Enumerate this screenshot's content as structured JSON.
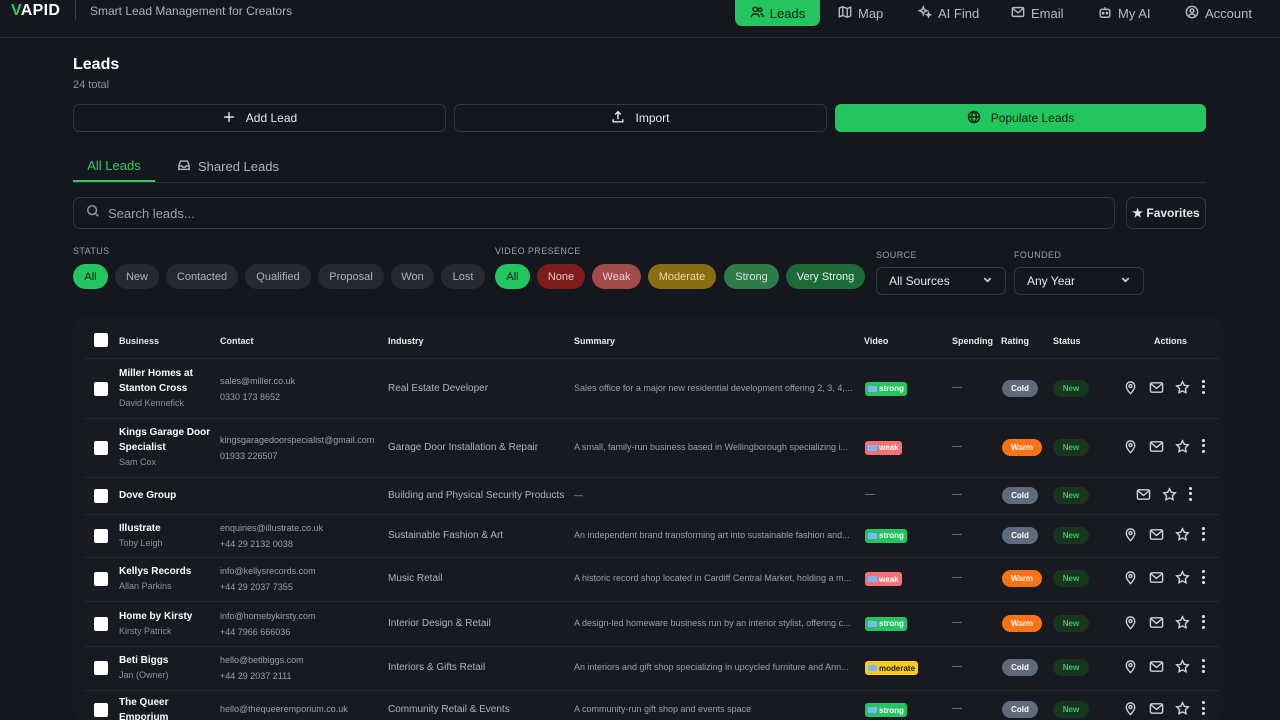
{
  "header": {
    "logo_prefix": "V",
    "logo_rest": "APID",
    "tagline": "Smart Lead Management for Creators",
    "nav": [
      {
        "label": "Leads",
        "icon": "users-icon",
        "active": true
      },
      {
        "label": "Map",
        "icon": "map-icon"
      },
      {
        "label": "AI Find",
        "icon": "sparkles-icon"
      },
      {
        "label": "Email",
        "icon": "mail-icon"
      },
      {
        "label": "My AI",
        "icon": "bot-icon"
      },
      {
        "label": "Account",
        "icon": "user-circle-icon"
      }
    ]
  },
  "page": {
    "title": "Leads",
    "subtitle": "24 total"
  },
  "actions": {
    "add": "Add Lead",
    "import": "Import",
    "populate": "Populate Leads"
  },
  "tabs": [
    {
      "label": "All Leads"
    },
    {
      "label": "Shared Leads"
    }
  ],
  "search": {
    "placeholder": "Search leads...",
    "favorites": "★ Favorites"
  },
  "filters": {
    "status_label": "STATUS",
    "status": [
      "All",
      "New",
      "Contacted",
      "Qualified",
      "Proposal",
      "Won",
      "Lost"
    ],
    "video_label": "VIDEO PRESENCE",
    "video": [
      "All",
      "None",
      "Weak",
      "Moderate",
      "Strong",
      "Very Strong"
    ],
    "source_label": "SOURCE",
    "source_value": "All Sources",
    "founded_label": "FOUNDED",
    "founded_value": "Any Year"
  },
  "colors": {
    "accent": "#22c55e",
    "cold": "#5f6b7c",
    "warm": "#f97316",
    "weak": "#f87171",
    "strong": "#22c55e",
    "moderate": "#facc15"
  },
  "table": {
    "columns": [
      "Business",
      "Contact",
      "Industry",
      "Summary",
      "Video",
      "Spending",
      "Rating",
      "Status",
      "Actions"
    ],
    "rows": [
      {
        "name1": "Miller Homes at",
        "name2": "Stanton Cross",
        "person": "David Kennefick",
        "email": "sales@miller.co.uk",
        "phone": "0330 173 8652",
        "industry": "Real Estate Developer",
        "summary": "Sales office for a major new residential development offering 2, 3, 4,...",
        "video": "strong",
        "spending": "—",
        "rating": "Cold",
        "status": "New"
      },
      {
        "name1": "Kings Garage Door",
        "name2": "Specialist",
        "person": "Sam Cox",
        "email": "kingsgaragedoorspecialist@gmail.com",
        "phone": "01933 226507",
        "industry": "Garage Door Installation & Repair",
        "summary": "A small, family-run business based in Wellingborough specializing i...",
        "video": "weak",
        "spending": "—",
        "rating": "Warm",
        "status": "New"
      },
      {
        "name1": "Dove Group",
        "name2": "",
        "person": "",
        "email": "",
        "phone": "",
        "industry": "Building and Physical Security Products",
        "summary": "—",
        "video": "—",
        "spending": "—",
        "rating": "Cold",
        "status": "New"
      },
      {
        "name1": "Illustrate",
        "name2": "",
        "person": "Toby Leigh",
        "email": "enquiries@illustrate.co.uk",
        "phone": "+44 29 2132 0038",
        "industry": "Sustainable Fashion & Art",
        "summary": "An independent brand transforming art into sustainable fashion and...",
        "video": "strong",
        "spending": "—",
        "rating": "Cold",
        "status": "New"
      },
      {
        "name1": "Kellys Records",
        "name2": "",
        "person": "Allan Parkins",
        "email": "info@kellysrecords.com",
        "phone": "+44 29 2037 7355",
        "industry": "Music Retail",
        "summary": "A historic record shop located in Cardiff Central Market, holding a m...",
        "video": "weak",
        "spending": "—",
        "rating": "Warm",
        "status": "New"
      },
      {
        "name1": "Home by Kirsty",
        "name2": "",
        "person": "Kirsty Patrick",
        "email": "info@homebykirsty.com",
        "phone": "+44 7966 666036",
        "industry": "Interior Design & Retail",
        "summary": "A design-led homeware business run by an interior stylist, offering c...",
        "video": "strong",
        "spending": "—",
        "rating": "Warm",
        "status": "New"
      },
      {
        "name1": "Beti Biggs",
        "name2": "",
        "person": "Jan (Owner)",
        "email": "hello@betibiggs.com",
        "phone": "+44 29 2037 2111",
        "industry": "Interiors & Gifts Retail",
        "summary": "An interiors and gift shop specializing in upcycled furniture and Ann...",
        "video": "moderate",
        "spending": "—",
        "rating": "Cold",
        "status": "New"
      },
      {
        "name1": "The Queer",
        "name2": "Emporium",
        "person": "",
        "email": "hello@thequeeremporium.co.uk",
        "phone": "",
        "industry": "Community Retail & Events",
        "summary": "A community-run gift shop and events space",
        "video": "strong",
        "spending": "—",
        "rating": "Cold",
        "status": "New"
      }
    ]
  }
}
